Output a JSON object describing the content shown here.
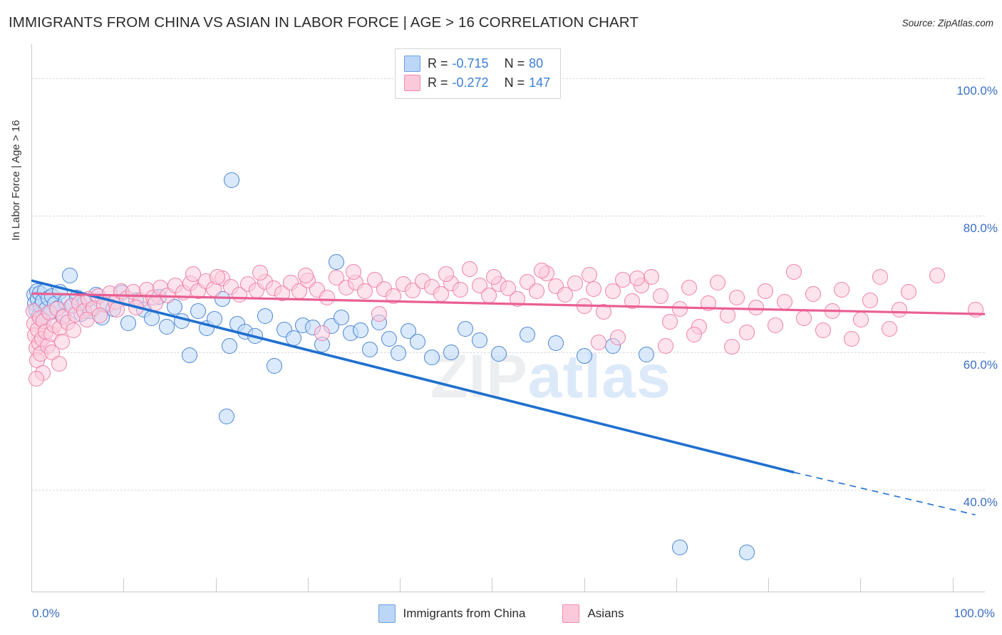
{
  "header": {
    "title": "IMMIGRANTS FROM CHINA VS ASIAN IN LABOR FORCE | AGE > 16 CORRELATION CHART",
    "source": "Source: ZipAtlas.com"
  },
  "watermark": {
    "part1": "ZIP",
    "part2": "atlas"
  },
  "stats": {
    "rows": [
      {
        "series": "Immigrants from China",
        "color": "#bcd6f7",
        "r_label": "R =",
        "r_value": "-0.715",
        "n_label": "N =",
        "n_value": "80"
      },
      {
        "series": "Asians",
        "color": "#fcc9da",
        "r_label": "R =",
        "r_value": "-0.272",
        "n_label": "N =",
        "n_value": "147"
      }
    ]
  },
  "legend": {
    "items": [
      {
        "label": "Immigrants from China",
        "color": "#bcd6f7"
      },
      {
        "label": "Asians",
        "color": "#fcc9da"
      }
    ]
  },
  "axes": {
    "y_title": "In Labor Force | Age > 16",
    "y_ticks": [
      "100.0%",
      "80.0%",
      "60.0%",
      "40.0%"
    ],
    "x_min_label": "0.0%",
    "x_max_label": "100.0%"
  },
  "chart_data": {
    "type": "scatter",
    "title": "IMMIGRANTS FROM CHINA VS ASIAN IN LABOR FORCE | AGE > 16 CORRELATION CHART",
    "xlabel": "Immigrants from China",
    "ylabel": "In Labor Force | Age > 16",
    "xlim": [
      0,
      100
    ],
    "ylim": [
      25,
      105
    ],
    "grid": true,
    "legend_position": "bottom-center",
    "y_gridlines": [
      100,
      80,
      60,
      40
    ],
    "series": [
      {
        "name": "Immigrants from China",
        "color": "#bcd6f7",
        "edge_color": "#4b84d6",
        "R": -0.715,
        "N": 80,
        "trendline": {
          "x0": 0,
          "y0": 70.5,
          "x1": 80,
          "y1": 42.5,
          "solid_to_x": 80,
          "dashed_to_x": 99,
          "dashed_y_end": 36.3
        },
        "points": [
          [
            0.3,
            68.4
          ],
          [
            0.4,
            67.2
          ],
          [
            0.5,
            66.1
          ],
          [
            0.6,
            69.0
          ],
          [
            0.7,
            67.8
          ],
          [
            0.8,
            65.4
          ],
          [
            0.9,
            68.6
          ],
          [
            1.0,
            66.8
          ],
          [
            1.1,
            64.9
          ],
          [
            1.2,
            67.5
          ],
          [
            1.4,
            68.9
          ],
          [
            1.6,
            66.3
          ],
          [
            1.8,
            67.9
          ],
          [
            2.0,
            65.8
          ],
          [
            2.2,
            68.2
          ],
          [
            2.5,
            67.1
          ],
          [
            2.8,
            66.5
          ],
          [
            3.0,
            68.8
          ],
          [
            3.3,
            65.2
          ],
          [
            3.6,
            67.4
          ],
          [
            4.0,
            71.2
          ],
          [
            4.3,
            66.9
          ],
          [
            4.8,
            68.0
          ],
          [
            5.2,
            65.6
          ],
          [
            5.6,
            67.3
          ],
          [
            6.2,
            66.0
          ],
          [
            6.8,
            68.4
          ],
          [
            7.4,
            65.1
          ],
          [
            8.0,
            67.0
          ],
          [
            8.6,
            66.4
          ],
          [
            9.5,
            68.7
          ],
          [
            10.2,
            64.3
          ],
          [
            11.0,
            67.6
          ],
          [
            11.8,
            66.2
          ],
          [
            12.6,
            65.0
          ],
          [
            13.4,
            68.1
          ],
          [
            14.2,
            63.8
          ],
          [
            15.0,
            66.7
          ],
          [
            15.8,
            64.6
          ],
          [
            16.6,
            59.6
          ],
          [
            17.5,
            66.0
          ],
          [
            18.4,
            63.5
          ],
          [
            19.2,
            64.9
          ],
          [
            20.0,
            67.8
          ],
          [
            20.8,
            61.0
          ],
          [
            21.6,
            64.2
          ],
          [
            22.4,
            63.0
          ],
          [
            21.0,
            85.2
          ],
          [
            20.5,
            50.7
          ],
          [
            23.5,
            62.4
          ],
          [
            24.5,
            65.3
          ],
          [
            25.5,
            58.0
          ],
          [
            26.5,
            63.3
          ],
          [
            27.5,
            62.1
          ],
          [
            28.5,
            64.0
          ],
          [
            29.5,
            63.6
          ],
          [
            30.5,
            61.2
          ],
          [
            31.5,
            63.9
          ],
          [
            32.5,
            65.1
          ],
          [
            33.5,
            62.8
          ],
          [
            34.5,
            63.2
          ],
          [
            35.5,
            60.4
          ],
          [
            32.0,
            73.2
          ],
          [
            36.5,
            64.4
          ],
          [
            37.5,
            62.0
          ],
          [
            38.5,
            59.9
          ],
          [
            39.5,
            63.1
          ],
          [
            40.5,
            61.6
          ],
          [
            42.0,
            59.3
          ],
          [
            44.0,
            60.0
          ],
          [
            45.5,
            63.4
          ],
          [
            47.0,
            61.8
          ],
          [
            49.0,
            59.8
          ],
          [
            52.0,
            62.6
          ],
          [
            55.0,
            61.4
          ],
          [
            58.0,
            59.5
          ],
          [
            61.0,
            61.0
          ],
          [
            64.5,
            59.7
          ],
          [
            68.0,
            31.5
          ],
          [
            75.0,
            30.8
          ]
        ]
      },
      {
        "name": "Asians",
        "color": "#fcc9da",
        "edge_color": "#ef7fa8",
        "R": -0.272,
        "N": 147,
        "trendline": {
          "x0": 0,
          "y0": 68.6,
          "x1": 100,
          "y1": 65.6
        },
        "points": [
          [
            0.2,
            66.0
          ],
          [
            0.3,
            64.2
          ],
          [
            0.4,
            62.5
          ],
          [
            0.5,
            60.6
          ],
          [
            0.6,
            58.9
          ],
          [
            0.7,
            63.3
          ],
          [
            0.8,
            61.4
          ],
          [
            0.9,
            65.0
          ],
          [
            1.0,
            59.8
          ],
          [
            1.1,
            62.0
          ],
          [
            1.3,
            64.6
          ],
          [
            1.5,
            63.0
          ],
          [
            1.7,
            61.0
          ],
          [
            1.9,
            65.8
          ],
          [
            2.1,
            62.7
          ],
          [
            2.4,
            64.0
          ],
          [
            2.7,
            66.3
          ],
          [
            3.0,
            63.5
          ],
          [
            3.4,
            65.2
          ],
          [
            3.8,
            64.4
          ],
          [
            4.2,
            66.8
          ],
          [
            4.6,
            65.5
          ],
          [
            5.0,
            67.2
          ],
          [
            5.5,
            66.0
          ],
          [
            6.0,
            67.8
          ],
          [
            6.5,
            66.5
          ],
          [
            7.0,
            68.2
          ],
          [
            7.6,
            67.0
          ],
          [
            8.2,
            68.6
          ],
          [
            8.8,
            67.4
          ],
          [
            9.4,
            69.0
          ],
          [
            10.0,
            67.9
          ],
          [
            10.7,
            68.8
          ],
          [
            11.4,
            67.6
          ],
          [
            12.1,
            69.2
          ],
          [
            12.8,
            68.0
          ],
          [
            13.5,
            69.5
          ],
          [
            14.3,
            68.3
          ],
          [
            15.1,
            69.8
          ],
          [
            15.9,
            68.7
          ],
          [
            16.7,
            70.1
          ],
          [
            17.5,
            69.0
          ],
          [
            18.3,
            70.4
          ],
          [
            19.1,
            69.3
          ],
          [
            20.0,
            70.8
          ],
          [
            20.9,
            69.6
          ],
          [
            21.8,
            68.4
          ],
          [
            22.7,
            70.0
          ],
          [
            23.6,
            69.1
          ],
          [
            24.5,
            70.3
          ],
          [
            25.4,
            69.4
          ],
          [
            26.3,
            68.6
          ],
          [
            27.2,
            70.2
          ],
          [
            28.1,
            69.0
          ],
          [
            29.0,
            70.5
          ],
          [
            30.0,
            69.2
          ],
          [
            31.0,
            68.0
          ],
          [
            32.0,
            70.9
          ],
          [
            33.0,
            69.5
          ],
          [
            34.0,
            70.2
          ],
          [
            35.0,
            69.0
          ],
          [
            36.0,
            70.6
          ],
          [
            37.0,
            69.3
          ],
          [
            38.0,
            68.2
          ],
          [
            39.0,
            70.0
          ],
          [
            40.0,
            69.1
          ],
          [
            41.0,
            70.4
          ],
          [
            42.0,
            69.6
          ],
          [
            43.0,
            68.5
          ],
          [
            44.0,
            70.1
          ],
          [
            45.0,
            69.2
          ],
          [
            46.0,
            72.2
          ],
          [
            47.0,
            69.8
          ],
          [
            48.0,
            68.3
          ],
          [
            49.0,
            70.0
          ],
          [
            50.0,
            69.4
          ],
          [
            51.0,
            67.8
          ],
          [
            52.0,
            70.3
          ],
          [
            53.0,
            69.0
          ],
          [
            54.0,
            71.5
          ],
          [
            55.0,
            69.7
          ],
          [
            56.0,
            68.4
          ],
          [
            57.0,
            70.1
          ],
          [
            58.0,
            66.8
          ],
          [
            59.0,
            69.3
          ],
          [
            60.0,
            65.9
          ],
          [
            61.0,
            68.9
          ],
          [
            62.0,
            70.6
          ],
          [
            63.0,
            67.5
          ],
          [
            64.0,
            69.8
          ],
          [
            65.0,
            71.0
          ],
          [
            66.0,
            68.2
          ],
          [
            67.0,
            64.5
          ],
          [
            68.0,
            66.3
          ],
          [
            69.0,
            69.5
          ],
          [
            70.0,
            63.8
          ],
          [
            71.0,
            67.2
          ],
          [
            72.0,
            70.2
          ],
          [
            73.0,
            65.4
          ],
          [
            74.0,
            68.0
          ],
          [
            75.0,
            62.9
          ],
          [
            76.0,
            66.6
          ],
          [
            77.0,
            69.0
          ],
          [
            78.0,
            64.0
          ],
          [
            79.0,
            67.4
          ],
          [
            80.0,
            71.8
          ],
          [
            81.0,
            65.0
          ],
          [
            82.0,
            68.5
          ],
          [
            83.0,
            63.2
          ],
          [
            84.0,
            66.0
          ],
          [
            85.0,
            69.2
          ],
          [
            86.0,
            62.0
          ],
          [
            87.0,
            64.8
          ],
          [
            88.0,
            67.6
          ],
          [
            89.0,
            71.0
          ],
          [
            90.0,
            63.4
          ],
          [
            91.0,
            66.2
          ],
          [
            92.0,
            68.8
          ],
          [
            95.0,
            71.2
          ],
          [
            99.0,
            66.2
          ],
          [
            17.0,
            71.4
          ],
          [
            19.5,
            71.0
          ],
          [
            24.0,
            71.6
          ],
          [
            28.8,
            71.2
          ],
          [
            33.8,
            71.8
          ],
          [
            43.5,
            71.4
          ],
          [
            48.5,
            71.0
          ],
          [
            53.5,
            72.0
          ],
          [
            58.5,
            71.3
          ],
          [
            63.5,
            70.8
          ],
          [
            2.2,
            60.0
          ],
          [
            2.9,
            58.4
          ],
          [
            1.2,
            57.0
          ],
          [
            0.55,
            56.2
          ],
          [
            3.2,
            61.6
          ],
          [
            4.4,
            63.2
          ],
          [
            5.8,
            64.8
          ],
          [
            7.2,
            65.4
          ],
          [
            9.0,
            66.2
          ],
          [
            11.0,
            66.6
          ],
          [
            13.0,
            67.2
          ],
          [
            30.5,
            62.8
          ],
          [
            36.5,
            65.6
          ],
          [
            59.5,
            61.5
          ],
          [
            61.5,
            62.2
          ],
          [
            66.5,
            61.0
          ],
          [
            69.5,
            62.6
          ],
          [
            73.5,
            60.8
          ]
        ]
      }
    ]
  }
}
